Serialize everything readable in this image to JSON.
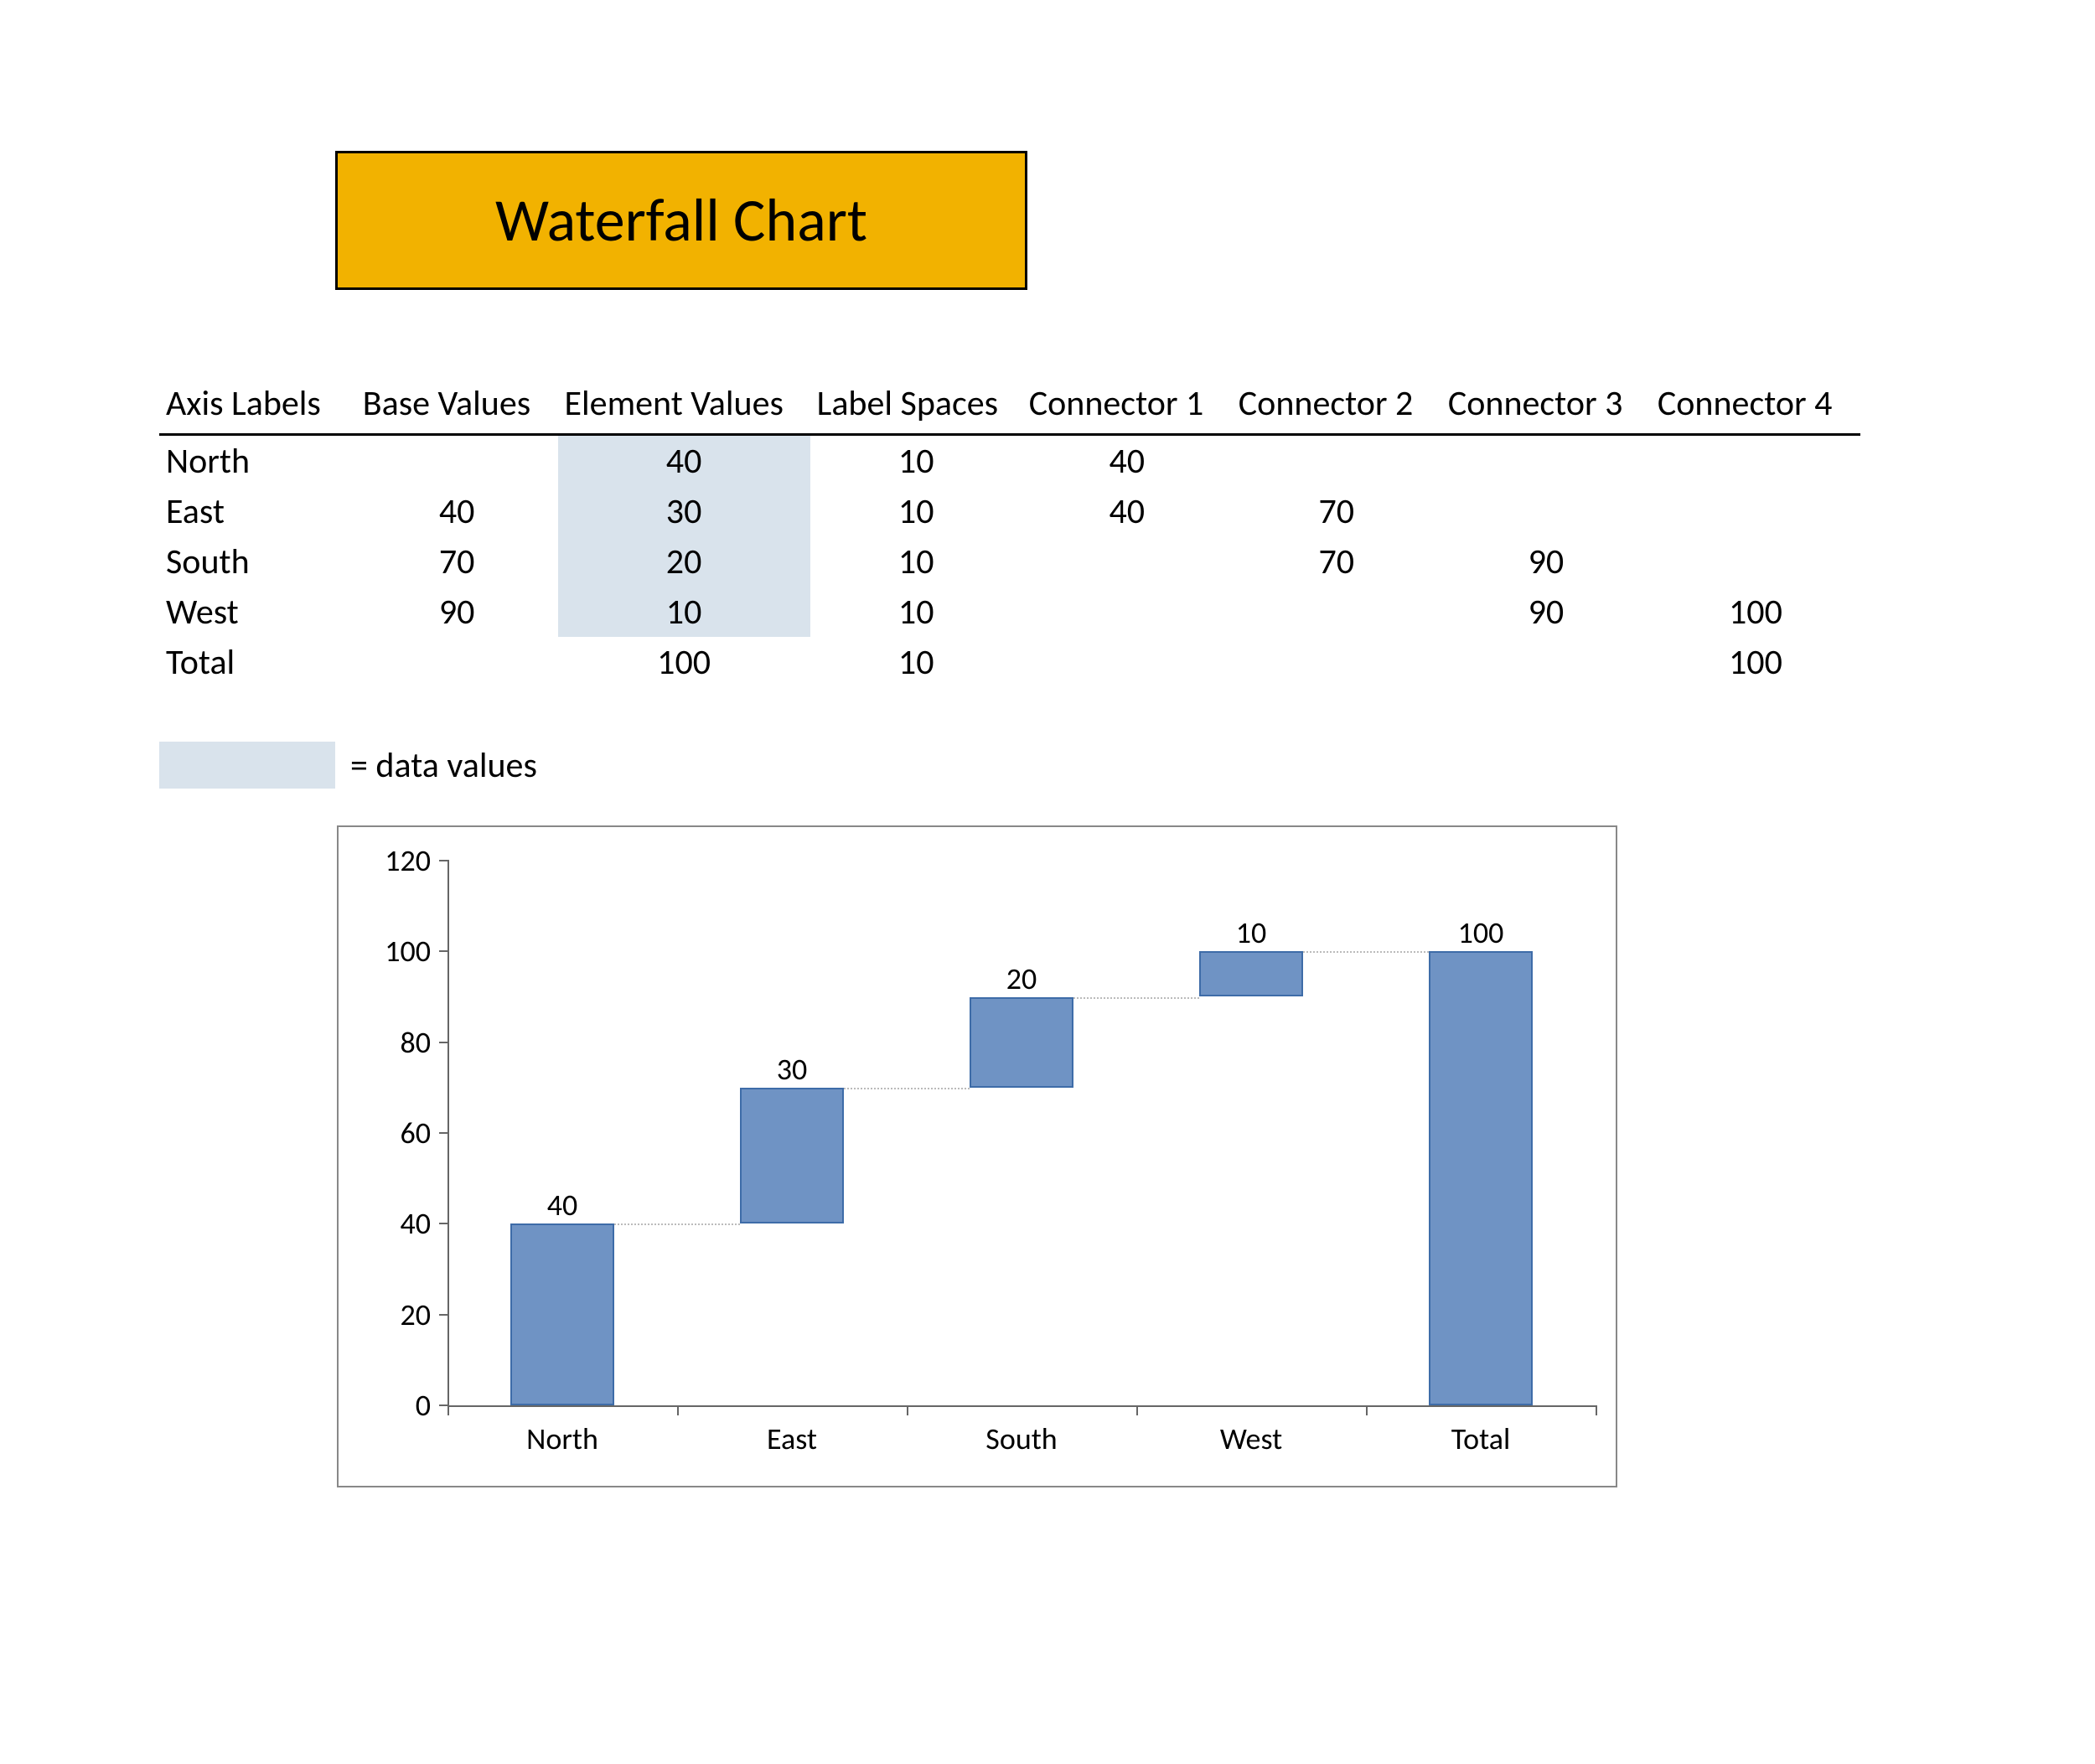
{
  "title": "Waterfall Chart",
  "table": {
    "headers": [
      "Axis Labels",
      "Base Values",
      "Element Values",
      "Label Spaces",
      "Connector 1",
      "Connector 2",
      "Connector 3",
      "Connector 4"
    ],
    "rows": [
      {
        "axis": "North",
        "base": "",
        "element": "40",
        "label_space": "10",
        "c1": "40",
        "c2": "",
        "c3": "",
        "c4": ""
      },
      {
        "axis": "East",
        "base": "40",
        "element": "30",
        "label_space": "10",
        "c1": "40",
        "c2": "70",
        "c3": "",
        "c4": ""
      },
      {
        "axis": "South",
        "base": "70",
        "element": "20",
        "label_space": "10",
        "c1": "",
        "c2": "70",
        "c3": "90",
        "c4": ""
      },
      {
        "axis": "West",
        "base": "90",
        "element": "10",
        "label_space": "10",
        "c1": "",
        "c2": "",
        "c3": "90",
        "c4": "100"
      },
      {
        "axis": "Total",
        "base": "",
        "element": "100",
        "label_space": "10",
        "c1": "",
        "c2": "",
        "c3": "",
        "c4": "100"
      }
    ],
    "shaded_element_rows": [
      0,
      1,
      2,
      3
    ]
  },
  "legend": {
    "text": "= data values"
  },
  "chart_data": {
    "type": "bar",
    "subtype": "waterfall",
    "categories": [
      "North",
      "East",
      "South",
      "West",
      "Total"
    ],
    "base": [
      0,
      40,
      70,
      90,
      0
    ],
    "values": [
      40,
      30,
      20,
      10,
      100
    ],
    "data_labels": [
      "40",
      "30",
      "20",
      "10",
      "100"
    ],
    "y_ticks": [
      0,
      20,
      40,
      60,
      80,
      100,
      120
    ],
    "ylim": [
      0,
      120
    ],
    "title": "",
    "xlabel": "",
    "ylabel": "",
    "bar_color": "#6f93c4",
    "bar_border": "#3e6ca8"
  }
}
